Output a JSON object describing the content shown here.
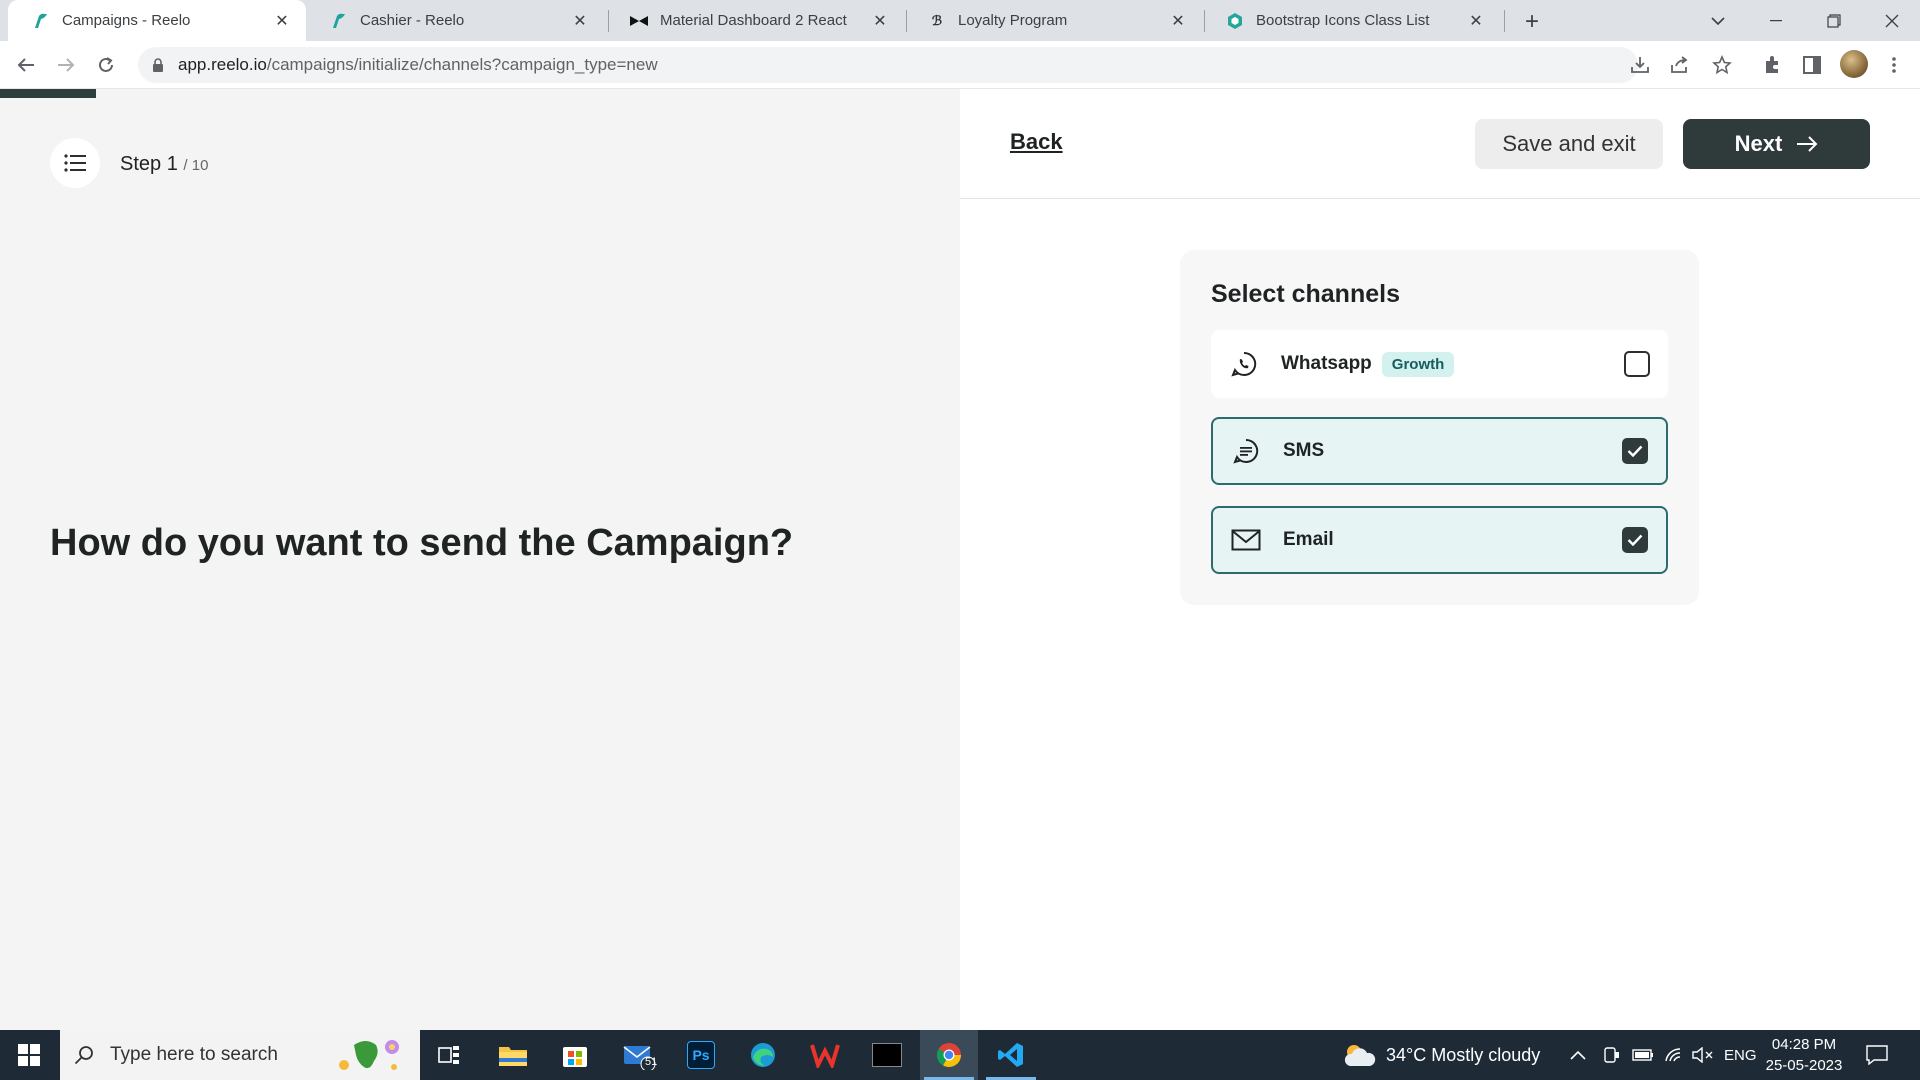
{
  "browser": {
    "tabs": [
      {
        "title": "Campaigns - Reelo",
        "icon": "reelo-icon",
        "active": true
      },
      {
        "title": "Cashier - Reelo",
        "icon": "reelo-icon",
        "active": false
      },
      {
        "title": "Material Dashboard 2 React",
        "icon": "material-icon",
        "active": false
      },
      {
        "title": "Loyalty Program",
        "icon": "loyalty-icon",
        "active": false
      },
      {
        "title": "Bootstrap Icons Class List",
        "icon": "bootstrap-icon",
        "active": false
      }
    ],
    "url_host": "app.reelo.io",
    "url_path": "/campaigns/initialize/channels?campaign_type=new"
  },
  "page": {
    "step_current": "Step 1",
    "step_total": "/ 10",
    "question": "How do you want to send the Campaign?",
    "back_label": "Back",
    "save_label": "Save and exit",
    "next_label": "Next"
  },
  "channels": {
    "title": "Select channels",
    "items": [
      {
        "name": "Whatsapp",
        "badge": "Growth",
        "checked": false,
        "icon": "whatsapp-icon"
      },
      {
        "name": "SMS",
        "badge": "",
        "checked": true,
        "icon": "chat-icon"
      },
      {
        "name": "Email",
        "badge": "",
        "checked": true,
        "icon": "envelope-icon"
      }
    ]
  },
  "colors": {
    "accent_dark": "#2f3b3a",
    "selected_bg": "#e6f4f3",
    "selected_border": "#2e6b6d",
    "badge_bg": "#d2f1ef"
  },
  "taskbar": {
    "search_placeholder": "Type here to search",
    "mail_badge": "51",
    "weather": "34°C  Mostly cloudy",
    "language": "ENG",
    "time": "04:28 PM",
    "date": "25-05-2023"
  }
}
